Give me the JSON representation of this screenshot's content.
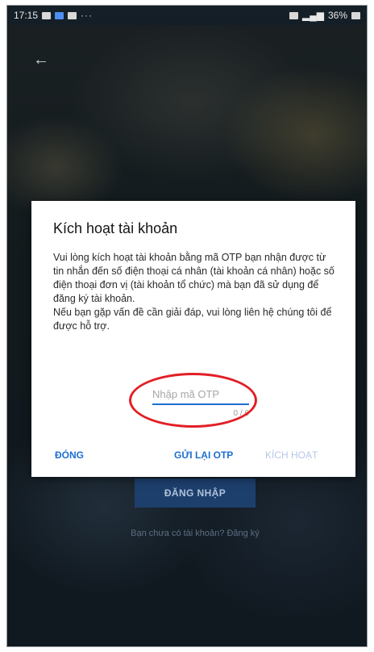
{
  "status_bar": {
    "time": "17:15",
    "right": "36%"
  },
  "behind": {
    "login_label": "ĐĂNG NHẬP",
    "register_text": "Bạn chưa có tài khoản?  Đăng ký"
  },
  "dialog": {
    "title": "Kích hoạt tài khoản",
    "body_line_1": "Vui lòng kích hoạt tài khoản bằng mã OTP bạn nhận được từ tin nhắn đến số điện thoại cá nhân (tài khoản cá nhân) hoặc số điện thoại đơn vị (tài khoản tổ chức) mà bạn đã sử dụng để đăng ký tài khoản.",
    "body_line_2": "Nếu bạn gặp vấn đề cần giải đáp, vui lòng liên hệ chúng tôi để được hỗ trợ.",
    "otp": {
      "placeholder": "Nhập mã OTP",
      "counter": "0 / 6"
    },
    "buttons": {
      "close": "ĐÓNG",
      "resend": "GỬI LẠI OTP",
      "activate": "KÍCH HOẠT"
    }
  },
  "colors": {
    "accent": "#1e6fd1",
    "highlight_circle": "#e21f26"
  }
}
